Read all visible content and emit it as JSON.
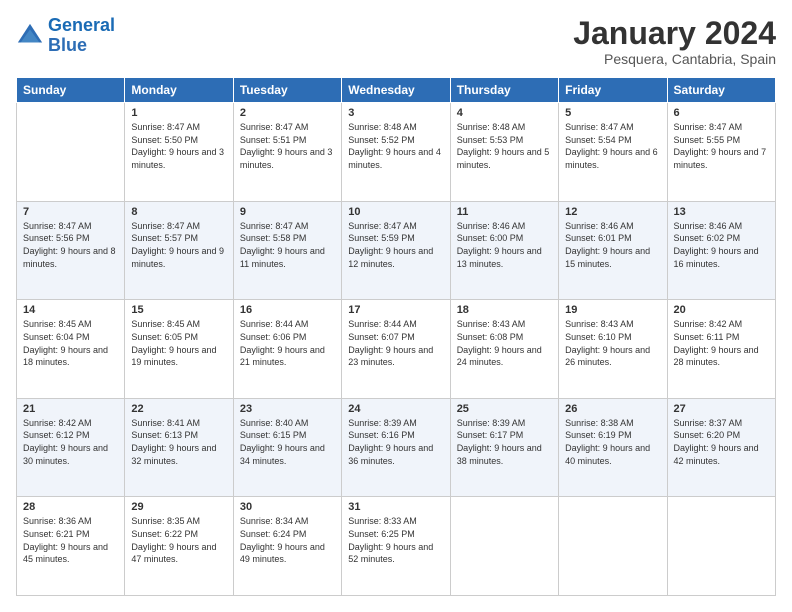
{
  "logo": {
    "line1": "General",
    "line2": "Blue"
  },
  "title": "January 2024",
  "subtitle": "Pesquera, Cantabria, Spain",
  "headers": [
    "Sunday",
    "Monday",
    "Tuesday",
    "Wednesday",
    "Thursday",
    "Friday",
    "Saturday"
  ],
  "weeks": [
    [
      {
        "day": "",
        "sunrise": "",
        "sunset": "",
        "daylight": ""
      },
      {
        "day": "1",
        "sunrise": "Sunrise: 8:47 AM",
        "sunset": "Sunset: 5:50 PM",
        "daylight": "Daylight: 9 hours and 3 minutes."
      },
      {
        "day": "2",
        "sunrise": "Sunrise: 8:47 AM",
        "sunset": "Sunset: 5:51 PM",
        "daylight": "Daylight: 9 hours and 3 minutes."
      },
      {
        "day": "3",
        "sunrise": "Sunrise: 8:48 AM",
        "sunset": "Sunset: 5:52 PM",
        "daylight": "Daylight: 9 hours and 4 minutes."
      },
      {
        "day": "4",
        "sunrise": "Sunrise: 8:48 AM",
        "sunset": "Sunset: 5:53 PM",
        "daylight": "Daylight: 9 hours and 5 minutes."
      },
      {
        "day": "5",
        "sunrise": "Sunrise: 8:47 AM",
        "sunset": "Sunset: 5:54 PM",
        "daylight": "Daylight: 9 hours and 6 minutes."
      },
      {
        "day": "6",
        "sunrise": "Sunrise: 8:47 AM",
        "sunset": "Sunset: 5:55 PM",
        "daylight": "Daylight: 9 hours and 7 minutes."
      }
    ],
    [
      {
        "day": "7",
        "sunrise": "Sunrise: 8:47 AM",
        "sunset": "Sunset: 5:56 PM",
        "daylight": "Daylight: 9 hours and 8 minutes."
      },
      {
        "day": "8",
        "sunrise": "Sunrise: 8:47 AM",
        "sunset": "Sunset: 5:57 PM",
        "daylight": "Daylight: 9 hours and 9 minutes."
      },
      {
        "day": "9",
        "sunrise": "Sunrise: 8:47 AM",
        "sunset": "Sunset: 5:58 PM",
        "daylight": "Daylight: 9 hours and 11 minutes."
      },
      {
        "day": "10",
        "sunrise": "Sunrise: 8:47 AM",
        "sunset": "Sunset: 5:59 PM",
        "daylight": "Daylight: 9 hours and 12 minutes."
      },
      {
        "day": "11",
        "sunrise": "Sunrise: 8:46 AM",
        "sunset": "Sunset: 6:00 PM",
        "daylight": "Daylight: 9 hours and 13 minutes."
      },
      {
        "day": "12",
        "sunrise": "Sunrise: 8:46 AM",
        "sunset": "Sunset: 6:01 PM",
        "daylight": "Daylight: 9 hours and 15 minutes."
      },
      {
        "day": "13",
        "sunrise": "Sunrise: 8:46 AM",
        "sunset": "Sunset: 6:02 PM",
        "daylight": "Daylight: 9 hours and 16 minutes."
      }
    ],
    [
      {
        "day": "14",
        "sunrise": "Sunrise: 8:45 AM",
        "sunset": "Sunset: 6:04 PM",
        "daylight": "Daylight: 9 hours and 18 minutes."
      },
      {
        "day": "15",
        "sunrise": "Sunrise: 8:45 AM",
        "sunset": "Sunset: 6:05 PM",
        "daylight": "Daylight: 9 hours and 19 minutes."
      },
      {
        "day": "16",
        "sunrise": "Sunrise: 8:44 AM",
        "sunset": "Sunset: 6:06 PM",
        "daylight": "Daylight: 9 hours and 21 minutes."
      },
      {
        "day": "17",
        "sunrise": "Sunrise: 8:44 AM",
        "sunset": "Sunset: 6:07 PM",
        "daylight": "Daylight: 9 hours and 23 minutes."
      },
      {
        "day": "18",
        "sunrise": "Sunrise: 8:43 AM",
        "sunset": "Sunset: 6:08 PM",
        "daylight": "Daylight: 9 hours and 24 minutes."
      },
      {
        "day": "19",
        "sunrise": "Sunrise: 8:43 AM",
        "sunset": "Sunset: 6:10 PM",
        "daylight": "Daylight: 9 hours and 26 minutes."
      },
      {
        "day": "20",
        "sunrise": "Sunrise: 8:42 AM",
        "sunset": "Sunset: 6:11 PM",
        "daylight": "Daylight: 9 hours and 28 minutes."
      }
    ],
    [
      {
        "day": "21",
        "sunrise": "Sunrise: 8:42 AM",
        "sunset": "Sunset: 6:12 PM",
        "daylight": "Daylight: 9 hours and 30 minutes."
      },
      {
        "day": "22",
        "sunrise": "Sunrise: 8:41 AM",
        "sunset": "Sunset: 6:13 PM",
        "daylight": "Daylight: 9 hours and 32 minutes."
      },
      {
        "day": "23",
        "sunrise": "Sunrise: 8:40 AM",
        "sunset": "Sunset: 6:15 PM",
        "daylight": "Daylight: 9 hours and 34 minutes."
      },
      {
        "day": "24",
        "sunrise": "Sunrise: 8:39 AM",
        "sunset": "Sunset: 6:16 PM",
        "daylight": "Daylight: 9 hours and 36 minutes."
      },
      {
        "day": "25",
        "sunrise": "Sunrise: 8:39 AM",
        "sunset": "Sunset: 6:17 PM",
        "daylight": "Daylight: 9 hours and 38 minutes."
      },
      {
        "day": "26",
        "sunrise": "Sunrise: 8:38 AM",
        "sunset": "Sunset: 6:19 PM",
        "daylight": "Daylight: 9 hours and 40 minutes."
      },
      {
        "day": "27",
        "sunrise": "Sunrise: 8:37 AM",
        "sunset": "Sunset: 6:20 PM",
        "daylight": "Daylight: 9 hours and 42 minutes."
      }
    ],
    [
      {
        "day": "28",
        "sunrise": "Sunrise: 8:36 AM",
        "sunset": "Sunset: 6:21 PM",
        "daylight": "Daylight: 9 hours and 45 minutes."
      },
      {
        "day": "29",
        "sunrise": "Sunrise: 8:35 AM",
        "sunset": "Sunset: 6:22 PM",
        "daylight": "Daylight: 9 hours and 47 minutes."
      },
      {
        "day": "30",
        "sunrise": "Sunrise: 8:34 AM",
        "sunset": "Sunset: 6:24 PM",
        "daylight": "Daylight: 9 hours and 49 minutes."
      },
      {
        "day": "31",
        "sunrise": "Sunrise: 8:33 AM",
        "sunset": "Sunset: 6:25 PM",
        "daylight": "Daylight: 9 hours and 52 minutes."
      },
      {
        "day": "",
        "sunrise": "",
        "sunset": "",
        "daylight": ""
      },
      {
        "day": "",
        "sunrise": "",
        "sunset": "",
        "daylight": ""
      },
      {
        "day": "",
        "sunrise": "",
        "sunset": "",
        "daylight": ""
      }
    ]
  ]
}
